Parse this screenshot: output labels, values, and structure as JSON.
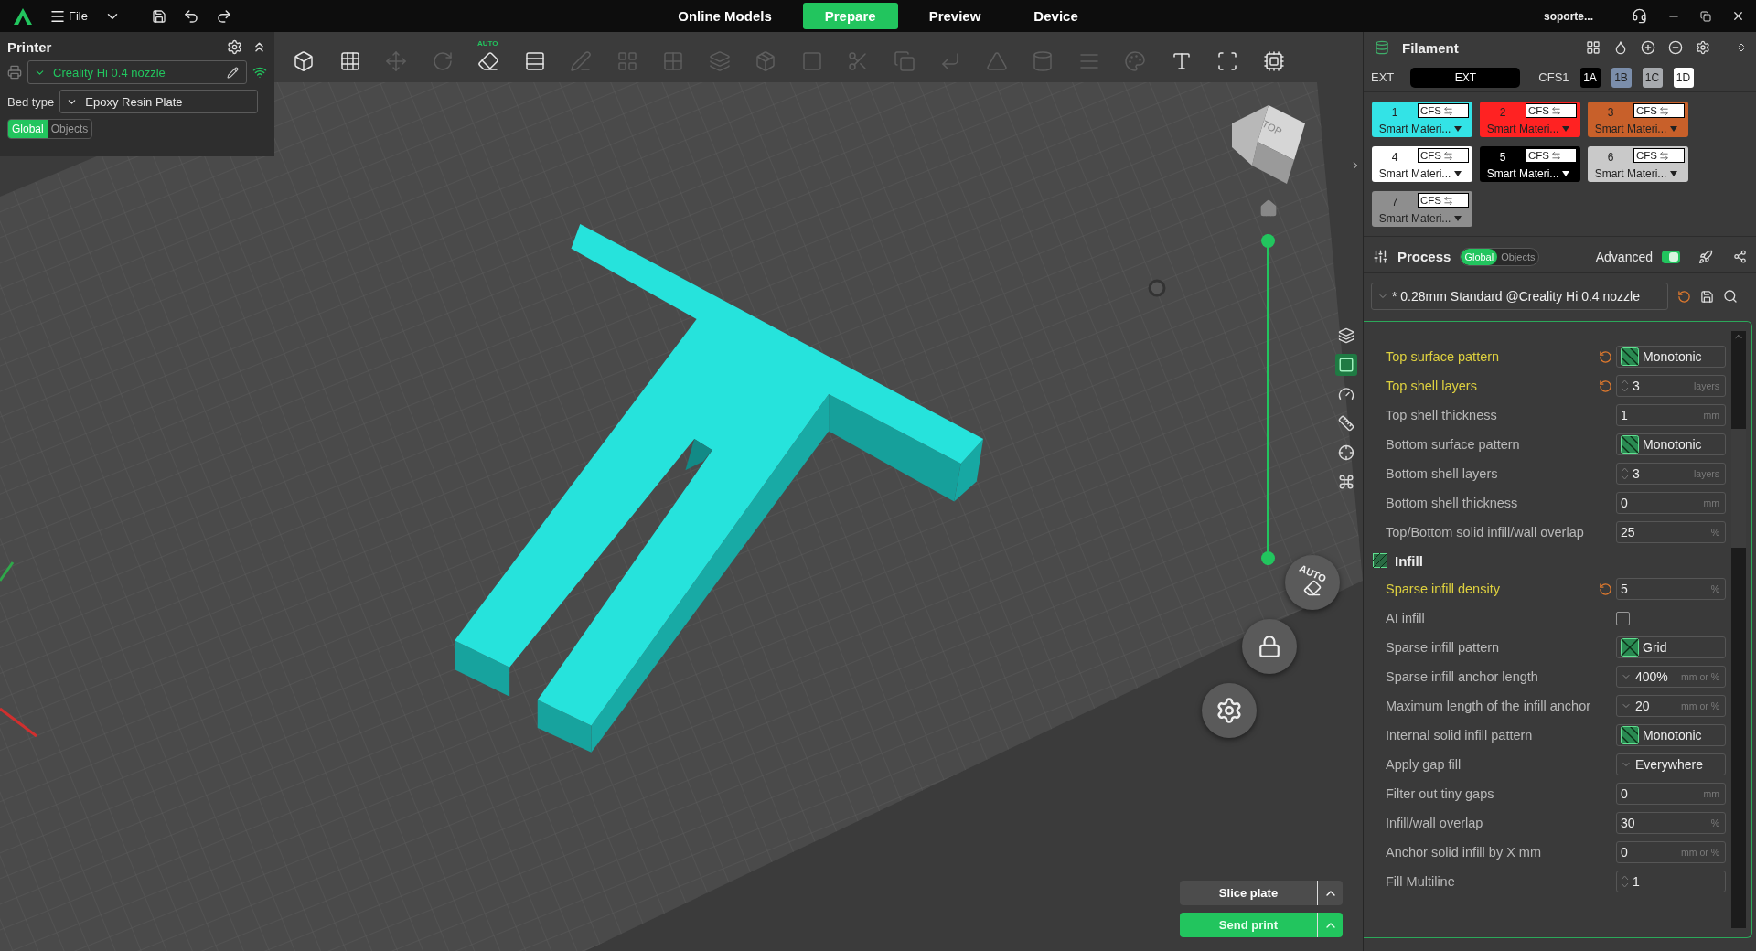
{
  "top_bar": {
    "menu_label": "File",
    "tabs": [
      {
        "label": "Online Models",
        "selected": false
      },
      {
        "label": "Prepare",
        "selected": true
      },
      {
        "label": "Preview",
        "selected": false
      },
      {
        "label": "Device",
        "selected": false
      }
    ],
    "user": "soporte..."
  },
  "printer_panel": {
    "title": "Printer",
    "printer": "Creality Hi 0.4 nozzle",
    "bed_type_label": "Bed type",
    "bed_type": "Epoxy Resin Plate",
    "scope": [
      {
        "label": "Global",
        "selected": true
      },
      {
        "label": "Objects",
        "selected": false
      }
    ]
  },
  "toolbar": {
    "tools": [
      {
        "disabled": false
      },
      {
        "disabled": false
      },
      {
        "disabled": true
      },
      {
        "disabled": true
      },
      {
        "disabled": false,
        "badge": "AUTO"
      },
      {
        "disabled": false
      },
      {
        "disabled": true
      },
      {
        "disabled": true
      },
      {
        "disabled": true
      },
      {
        "disabled": true
      },
      {
        "disabled": true
      },
      {
        "disabled": true
      },
      {
        "disabled": true
      },
      {
        "disabled": true
      },
      {
        "disabled": true
      },
      {
        "disabled": true
      },
      {
        "disabled": true
      },
      {
        "disabled": true
      },
      {
        "disabled": true
      },
      {
        "disabled": false
      },
      {
        "disabled": false
      },
      {
        "disabled": false
      }
    ]
  },
  "viewport": {
    "view_cube_label": "TOP",
    "layer_slider": {
      "level": 1
    },
    "side_tools": [
      {
        "selected": false
      },
      {
        "selected": true
      },
      {
        "selected": false
      },
      {
        "selected": false
      },
      {
        "selected": false
      },
      {
        "selected": false
      }
    ],
    "auto_button_label": "AUTO",
    "slice_button": "Slice plate",
    "send_button": "Send print"
  },
  "filament": {
    "title": "Filament",
    "ext_label": "EXT",
    "ext_slot": "EXT",
    "cfs_label": "CFS1",
    "slots": [
      {
        "label": "1A",
        "color": "#000000"
      },
      {
        "label": "1B",
        "color": "#7b8eab"
      },
      {
        "label": "1C",
        "color": "#a7aaae"
      },
      {
        "label": "1D",
        "color": "#ffffff"
      }
    ],
    "cards": [
      {
        "number": "1",
        "color": "#33e3e6",
        "source": "CFS",
        "material": "Smart Materi..."
      },
      {
        "number": "2",
        "color": "#ff2222",
        "source": "CFS",
        "material": "Smart Materi..."
      },
      {
        "number": "3",
        "color": "#c8602a",
        "source": "CFS",
        "material": "Smart Materi..."
      },
      {
        "number": "4",
        "color": "#ffffff",
        "source": "CFS",
        "material": "Smart Materi..."
      },
      {
        "number": "5",
        "color": "#000000",
        "source": "CFS",
        "material": "Smart Materi..."
      },
      {
        "number": "6",
        "color": "#c9c9c9",
        "source": "CFS",
        "material": "Smart Materi..."
      },
      {
        "number": "7",
        "color": "#8e8e8e",
        "source": "CFS",
        "material": "Smart Materi..."
      }
    ]
  },
  "process": {
    "title": "Process",
    "scope": [
      {
        "label": "Global",
        "selected": true
      },
      {
        "label": "Objects",
        "selected": false
      }
    ],
    "advanced_label": "Advanced",
    "advanced_on": true,
    "preset": "* 0.28mm Standard @Creality Hi 0.4 nozzle",
    "settings": [
      {
        "kind": "pattern",
        "label": "Top surface pattern",
        "modified": true,
        "value": "Monotonic",
        "crosshatch": false
      },
      {
        "kind": "number",
        "label": "Top shell layers",
        "modified": true,
        "value": "3",
        "unit": "layers",
        "spinner": true
      },
      {
        "kind": "number",
        "label": "Top shell thickness",
        "modified": false,
        "value": "1",
        "unit": "mm",
        "spinner": false
      },
      {
        "kind": "pattern",
        "label": "Bottom surface pattern",
        "modified": false,
        "value": "Monotonic",
        "crosshatch": false
      },
      {
        "kind": "number",
        "label": "Bottom shell layers",
        "modified": false,
        "value": "3",
        "unit": "layers",
        "spinner": true
      },
      {
        "kind": "number",
        "label": "Bottom shell thickness",
        "modified": false,
        "value": "0",
        "unit": "mm",
        "spinner": false
      },
      {
        "kind": "number",
        "label": "Top/Bottom solid infill/wall overlap",
        "modified": false,
        "value": "25",
        "unit": "%",
        "spinner": false
      },
      {
        "kind": "section",
        "label": "Infill"
      },
      {
        "kind": "number",
        "label": "Sparse infill density",
        "modified": true,
        "value": "5",
        "unit": "%",
        "spinner": false
      },
      {
        "kind": "checkbox",
        "label": "AI infill",
        "modified": false,
        "checked": false
      },
      {
        "kind": "pattern",
        "label": "Sparse infill pattern",
        "modified": false,
        "value": "Grid",
        "crosshatch": true
      },
      {
        "kind": "dropdown",
        "label": "Sparse infill anchor length",
        "modified": false,
        "value": "400%",
        "unit": "mm or %"
      },
      {
        "kind": "dropdown",
        "label": "Maximum length of the infill anchor",
        "modified": false,
        "value": "20",
        "unit": "mm or %"
      },
      {
        "kind": "pattern",
        "label": "Internal solid infill pattern",
        "modified": false,
        "value": "Monotonic",
        "crosshatch": false
      },
      {
        "kind": "dropdown",
        "label": "Apply gap fill",
        "modified": false,
        "value": "Everywhere"
      },
      {
        "kind": "number",
        "label": "Filter out tiny gaps",
        "modified": false,
        "value": "0",
        "unit": "mm",
        "spinner": false
      },
      {
        "kind": "number",
        "label": "Infill/wall overlap",
        "modified": false,
        "value": "30",
        "unit": "%",
        "spinner": false
      },
      {
        "kind": "number",
        "label": "Anchor solid infill by X mm",
        "modified": false,
        "value": "0",
        "unit": "mm or %",
        "spinner": false
      },
      {
        "kind": "number",
        "label": "Fill Multiline",
        "modified": false,
        "value": "1",
        "spinner": true
      }
    ]
  }
}
